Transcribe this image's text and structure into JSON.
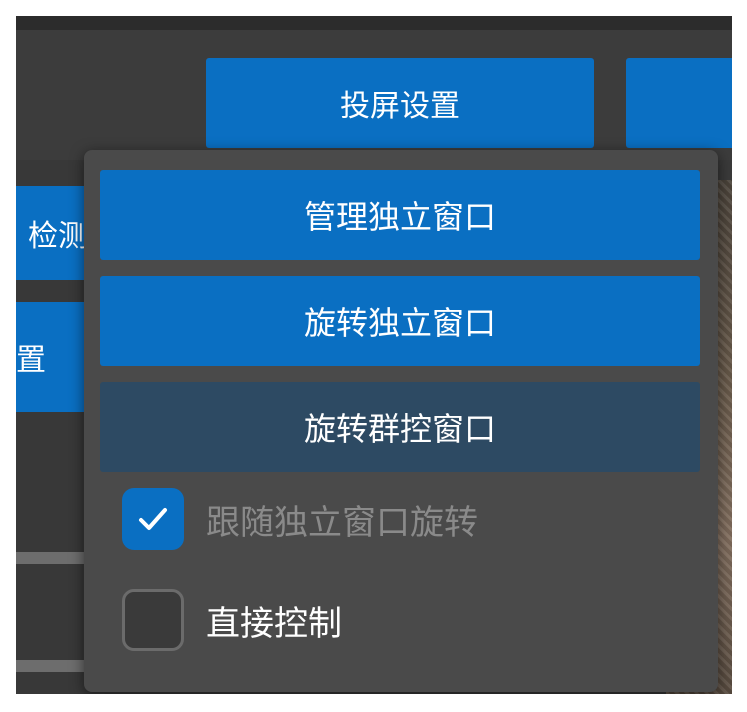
{
  "toolbar": {
    "cast_settings_label": "投屏设置"
  },
  "left_panel": {
    "detect_button_fragment": "检测",
    "settings_button_fragment": "置"
  },
  "popup": {
    "manage_window_label": "管理独立窗口",
    "rotate_window_label": "旋转独立窗口",
    "rotate_group_label": "旋转群控窗口",
    "follow_rotate": {
      "label": "跟随独立窗口旋转",
      "checked": true
    },
    "direct_control": {
      "label": "直接控制",
      "checked": false
    }
  },
  "colors": {
    "accent": "#0a6fc2",
    "dark_button": "#2d4a63",
    "popup_bg": "#4a4a4a"
  },
  "icons": {
    "check": "check-icon"
  }
}
